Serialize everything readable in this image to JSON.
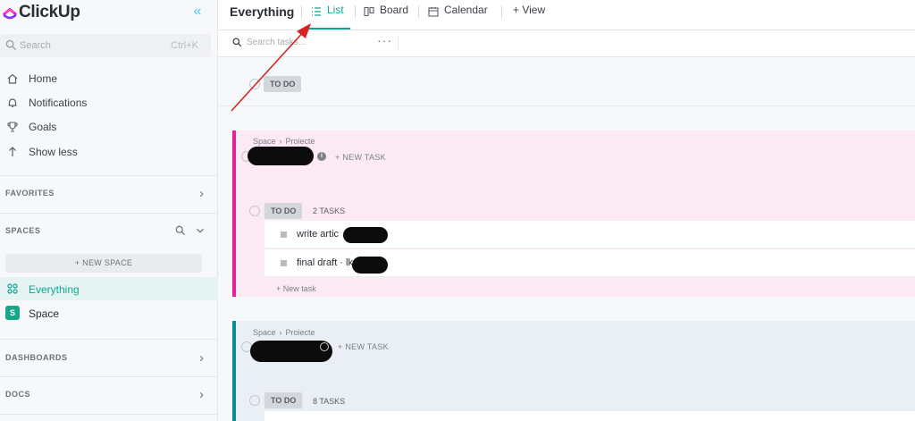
{
  "brand": {
    "name": "ClickUp"
  },
  "sidebar": {
    "search": {
      "placeholder": "Search",
      "shortcut": "Ctrl+K"
    },
    "nav": [
      {
        "label": "Home",
        "icon": "home-icon"
      },
      {
        "label": "Notifications",
        "icon": "bell-icon"
      },
      {
        "label": "Goals",
        "icon": "trophy-icon"
      },
      {
        "label": "Show less",
        "icon": "arrow-up-icon"
      }
    ],
    "sections": {
      "favorites": "FAVORITES",
      "spaces": "SPACES",
      "dashboards": "DASHBOARDS",
      "docs": "DOCS"
    },
    "new_space": "+ NEW SPACE",
    "spaces": [
      {
        "label": "Everything",
        "active": true
      },
      {
        "label": "Space",
        "badge": "S"
      }
    ]
  },
  "header": {
    "title": "Everything",
    "tabs": [
      {
        "label": "List",
        "active": true
      },
      {
        "label": "Board"
      },
      {
        "label": "Calendar"
      },
      {
        "label": "+ View"
      }
    ]
  },
  "toolbar": {
    "search_placeholder": "Search tasks...",
    "more": "···"
  },
  "groups": {
    "top": {
      "status": "TO DO"
    },
    "list1": {
      "breadcrumb": [
        "Space",
        "Proiecte"
      ],
      "new_task": "+ NEW TASK",
      "status": "TO DO",
      "count": "2 TASKS",
      "tasks": [
        {
          "name": "write artic"
        },
        {
          "name": "final draft · lkup"
        }
      ],
      "add_task": "+ New task",
      "color": "#e8219a"
    },
    "list2": {
      "breadcrumb": [
        "Space",
        "Proiecte"
      ],
      "new_task": "+ NEW TASK",
      "status": "TO DO",
      "count": "8 TASKS",
      "color": "#0d8a98"
    }
  },
  "colors": {
    "accent": "#0ba897",
    "list1_bg": "#fbe9f3",
    "list2_bg": "#e9eff5",
    "annotation_arrow": "#d62222"
  }
}
